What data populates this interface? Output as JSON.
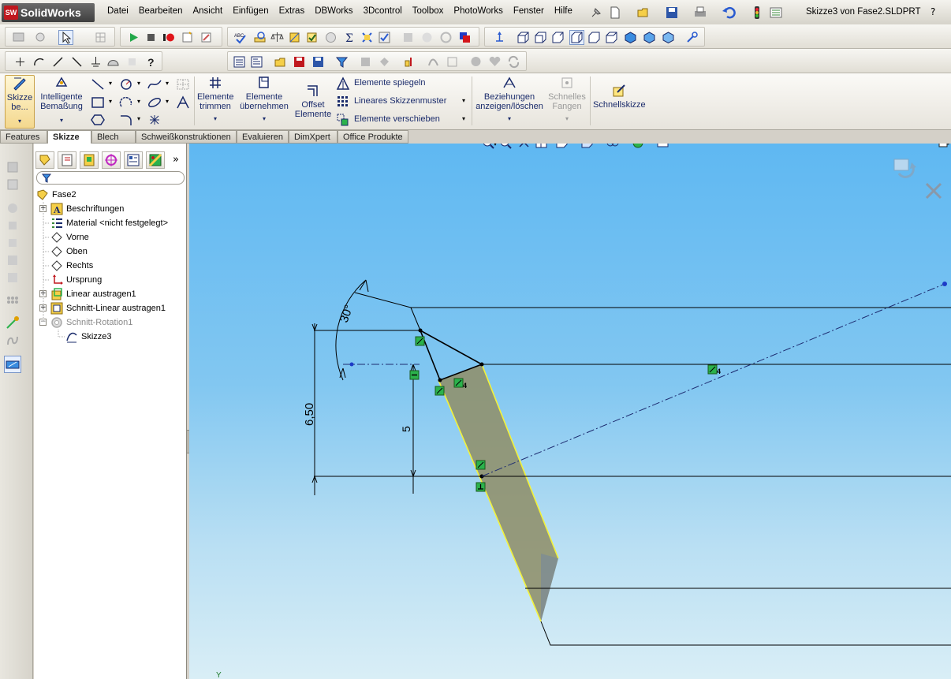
{
  "app": {
    "name": "SolidWorks",
    "logo_mark": "SW"
  },
  "menu": [
    "Datei",
    "Bearbeiten",
    "Ansicht",
    "Einfügen",
    "Extras",
    "DBWorks",
    "3Dcontrol",
    "Toolbox",
    "PhotoWorks",
    "Fenster",
    "Hilfe"
  ],
  "window": {
    "title": "Skizze3 von Fase2.SLDPRT",
    "help": "?"
  },
  "commands": {
    "sketch": "Skizze\nbe...",
    "smart_dimension": "Intelligente\nBemaßung",
    "trim": "Elemente\ntrimmen",
    "convert": "Elemente\nübernehmen",
    "offset": "Offset\nElemente",
    "mirror": "Elemente spiegeln",
    "linear_pattern": "Lineares Skizzenmuster",
    "move": "Elemente verschieben",
    "relations": "Beziehungen\nanzeigen/löschen",
    "quick_snaps": "Schnelles\nFangen",
    "rapid_sketch": "Schnellskizze"
  },
  "tabs": [
    {
      "label": "Features",
      "active": false
    },
    {
      "label": "Skizze",
      "active": true
    },
    {
      "label": "Blech",
      "active": false
    },
    {
      "label": "Schweißkonstruktionen",
      "active": false
    },
    {
      "label": "Evaluieren",
      "active": false
    },
    {
      "label": "DimXpert",
      "active": false
    },
    {
      "label": "Office Produkte",
      "active": false
    }
  ],
  "tree": {
    "root": "Fase2",
    "items": [
      {
        "label": "Beschriftungen",
        "expander": "+"
      },
      {
        "label": "Material <nicht festgelegt>",
        "expander": ""
      },
      {
        "label": "Vorne",
        "expander": ""
      },
      {
        "label": "Oben",
        "expander": ""
      },
      {
        "label": "Rechts",
        "expander": ""
      },
      {
        "label": "Ursprung",
        "expander": ""
      },
      {
        "label": "Linear austragen1",
        "expander": "+"
      },
      {
        "label": "Schnitt-Linear austragen1",
        "expander": "+"
      },
      {
        "label": "Schnitt-Rotation1",
        "expander": "−",
        "suppressed": true
      },
      {
        "label": "Skizze3",
        "expander": "",
        "child": true
      }
    ]
  },
  "sketch": {
    "dim_angle": "30°",
    "dim_height": "6,50",
    "dim_offset": "5",
    "relation_count": "4",
    "axis_label": "Y"
  },
  "colors": {
    "accent": "#1a2b6b",
    "relation_green": "#2bb24c",
    "sketch_line": "#000000",
    "edge_highlight": "#f2f23a"
  },
  "panel_tabs_more": "»"
}
